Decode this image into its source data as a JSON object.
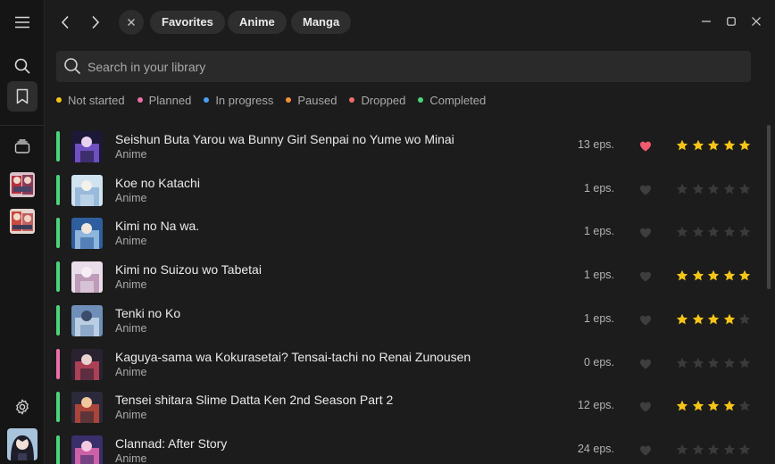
{
  "topbar": {
    "pills": [
      "Favorites",
      "Anime",
      "Manga"
    ]
  },
  "search": {
    "placeholder": "Search in your library"
  },
  "legend": [
    {
      "label": "Not started",
      "color": "#f5c518"
    },
    {
      "label": "Planned",
      "color": "#ec6fa7"
    },
    {
      "label": "In progress",
      "color": "#4a9ff5"
    },
    {
      "label": "Paused",
      "color": "#f0903a"
    },
    {
      "label": "Dropped",
      "color": "#ef6b6b"
    },
    {
      "label": "Completed",
      "color": "#4cd47a"
    }
  ],
  "library": [
    {
      "title": "Seishun Buta Yarou wa Bunny Girl Senpai no Yume wo Minai",
      "type": "Anime",
      "eps": "13 eps.",
      "status_color": "#4cd47a",
      "favorite": true,
      "rating": 5
    },
    {
      "title": "Koe no Katachi",
      "type": "Anime",
      "eps": "1 eps.",
      "status_color": "#4cd47a",
      "favorite": false,
      "rating": 0
    },
    {
      "title": "Kimi no Na wa.",
      "type": "Anime",
      "eps": "1 eps.",
      "status_color": "#4cd47a",
      "favorite": false,
      "rating": 0
    },
    {
      "title": "Kimi no Suizou wo Tabetai",
      "type": "Anime",
      "eps": "1 eps.",
      "status_color": "#4cd47a",
      "favorite": false,
      "rating": 5
    },
    {
      "title": "Tenki no Ko",
      "type": "Anime",
      "eps": "1 eps.",
      "status_color": "#4cd47a",
      "favorite": false,
      "rating": 4
    },
    {
      "title": "Kaguya-sama wa Kokurasetai? Tensai-tachi no Renai Zunousen",
      "type": "Anime",
      "eps": "0 eps.",
      "status_color": "#ec6fa7",
      "favorite": false,
      "rating": 0
    },
    {
      "title": "Tensei shitara Slime Datta Ken 2nd Season Part 2",
      "type": "Anime",
      "eps": "12 eps.",
      "status_color": "#4cd47a",
      "favorite": false,
      "rating": 4
    },
    {
      "title": "Clannad: After Story",
      "type": "Anime",
      "eps": "24 eps.",
      "status_color": "#4cd47a",
      "favorite": false,
      "rating": 0
    }
  ],
  "colors": {
    "star_on": "#f5c518",
    "star_off": "#3a3a3a",
    "heart_on": "#ef5b6e",
    "heart_off": "#3e3e3e"
  },
  "icons": [
    "menu-icon",
    "search-icon",
    "bookmark-icon",
    "library-icon",
    "gear-icon",
    "chevron-left-icon",
    "chevron-right-icon",
    "close-icon",
    "minimize-icon",
    "maximize-icon",
    "window-close-icon",
    "heart-icon",
    "star-icon"
  ]
}
